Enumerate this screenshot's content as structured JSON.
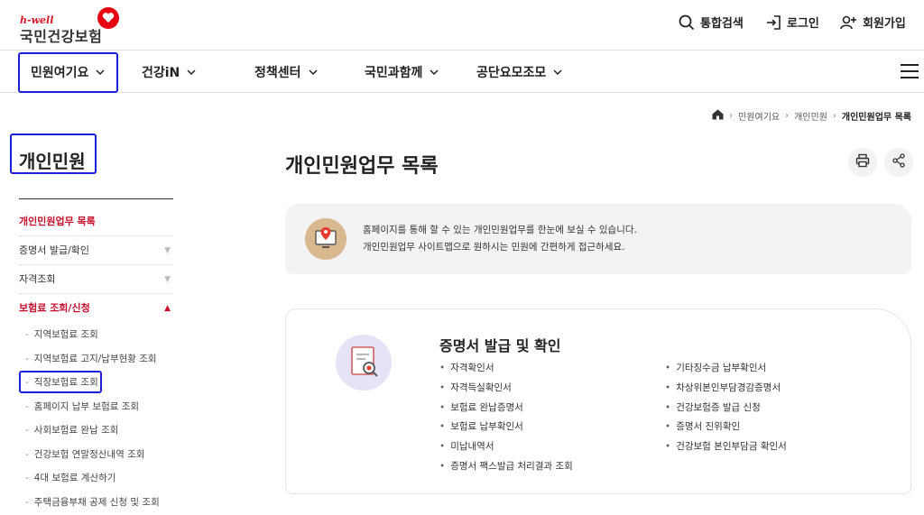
{
  "header": {
    "logo_sub": "h-well",
    "logo_main": "국민건강보험",
    "brand_color": "#e50012",
    "utilities": [
      {
        "label": "통합검색",
        "icon": "search-icon"
      },
      {
        "label": "로그인",
        "icon": "login-icon"
      },
      {
        "label": "회원가입",
        "icon": "add-user-icon"
      }
    ]
  },
  "nav": {
    "items": [
      {
        "label": "민원여기요"
      },
      {
        "label": "건강iN"
      },
      {
        "label": "정책센터"
      },
      {
        "label": "국민과함께"
      },
      {
        "label": "공단요모조모"
      }
    ],
    "menu_icon": "hamburger-menu-icon"
  },
  "breadcrumb": {
    "home_icon": "home-icon",
    "items": [
      "민원여기요",
      "개인민원",
      "개인민원업무 목록"
    ]
  },
  "sidebar": {
    "title": "개인민원",
    "items": [
      {
        "label": "개인민원업무 목록",
        "state": "active"
      },
      {
        "label": "증명서 발급/확인",
        "state": "collapsed"
      },
      {
        "label": "자격조회",
        "state": "collapsed"
      },
      {
        "label": "보험료 조회/신청",
        "state": "expanded"
      }
    ],
    "subitems": [
      "지역보험료 조회",
      "지역보험료 고지/납부현황 조회",
      "직장보험료 조회",
      "홈페이지 납부 보험료 조회",
      "사회보험료 완납 조회",
      "건강보험 연말정산내역 조회",
      "4대 보험료 계산하기",
      "주택금융부채 공제 신청 및 조회"
    ]
  },
  "main": {
    "title": "개인민원업무 목록",
    "actions": [
      {
        "icon": "print-icon"
      },
      {
        "icon": "share-icon"
      }
    ],
    "info": {
      "line1": "홈페이지를 통해 할 수 있는 개인민원업무를 한눈에 보실 수 있습니다.",
      "line2": "개인민원업무 사이트맵으로 원하시는 민원에 간편하게 접근하세요."
    },
    "card": {
      "title": "증명서 발급 및 확인",
      "col1": [
        "자격확인서",
        "자격득실확인서",
        "보험료 완납증명서",
        "보험료 납부확인서",
        "미납내역서",
        "증명서 팩스발급 처리결과 조회"
      ],
      "col2": [
        "기타징수금 납부확인서",
        "차상위본인부담경감증명서",
        "건강보험증 발급 신청",
        "증명서 진위확인",
        "건강보험 본인부담금 확인서"
      ]
    }
  },
  "colors": {
    "accent_red": "#c8102e",
    "annotation_blue": "#1a22d8"
  }
}
